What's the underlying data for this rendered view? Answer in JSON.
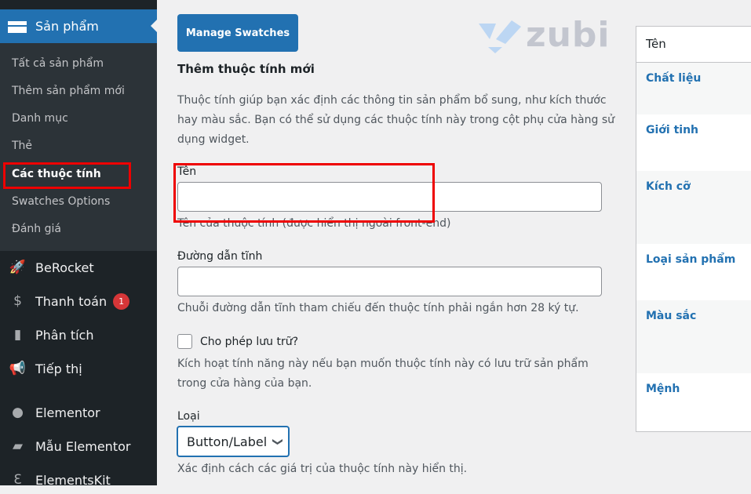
{
  "sidebar": {
    "current": {
      "label": "Sản phẩm",
      "icon": "archive-icon"
    },
    "submenu": [
      "Tất cả sản phẩm",
      "Thêm sản phẩm mới",
      "Danh mục",
      "Thẻ",
      "Các thuộc tính",
      "Swatches Options",
      "Đánh giá"
    ],
    "active_submenu": "Các thuộc tính",
    "items": [
      {
        "label": "BeRocket",
        "icon": "rocket-icon"
      },
      {
        "label": "Thanh toán",
        "icon": "dollar-icon",
        "badge": "1"
      },
      {
        "label": "Phân tích",
        "icon": "bar-chart-icon"
      },
      {
        "label": "Tiếp thị",
        "icon": "megaphone-icon"
      },
      {
        "label": "Elementor",
        "icon": "elementor-icon"
      },
      {
        "label": "Mẫu Elementor",
        "icon": "folder-icon"
      },
      {
        "label": "ElementsKit",
        "icon": "elementskit-icon"
      }
    ]
  },
  "main": {
    "manage_swatches": "Manage Swatches",
    "logo": "zubi",
    "title": "Thêm thuộc tính mới",
    "intro": "Thuộc tính giúp bạn xác định các thông tin sản phẩm bổ sung, như kích thước hay màu sắc. Bạn có thể sử dụng các thuộc tính này trong cột phụ cửa hàng sử dụng widget.",
    "name_label": "Tên",
    "name_value": "",
    "name_help": "Tên của thuộc tính (được hiển thị ngoài front-end)",
    "slug_label": "Đường dẫn tĩnh",
    "slug_value": "",
    "slug_help": "Chuỗi đường dẫn tĩnh tham chiếu đến thuộc tính phải ngắn hơn 28 ký tự.",
    "archive_label": "Cho phép lưu trữ?",
    "archive_checked": false,
    "archive_help": "Kích hoạt tính năng này nếu bạn muốn thuộc tính này có lưu trữ sản phẩm trong cửa hàng của bạn.",
    "type_label": "Loại",
    "type_value": "Button/Label",
    "type_help": "Xác định cách các giá trị của thuộc tính này hiển thị."
  },
  "table": {
    "header": "Tên",
    "rows": [
      "Chất liệu",
      "Giới tinh",
      "Kích cỡ",
      "Loại sản phẩm",
      "Màu sắc",
      "Mệnh"
    ]
  },
  "colors": {
    "accent": "#2271b1",
    "sidebar": "#1d2327",
    "highlight": "#ee0000",
    "badge": "#d63638"
  }
}
